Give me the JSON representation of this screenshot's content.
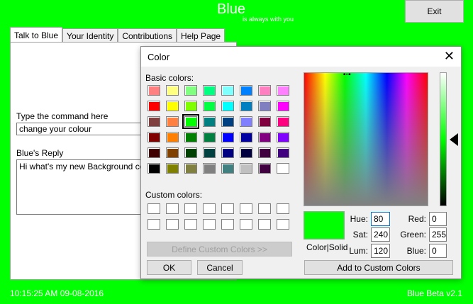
{
  "app": {
    "title": "Blue",
    "subtitle": "is always with you",
    "exit_label": "Exit"
  },
  "tabs": [
    {
      "label": "Talk to Blue",
      "active": true
    },
    {
      "label": "Your Identity",
      "active": false
    },
    {
      "label": "Contributions",
      "active": false
    },
    {
      "label": "Help Page",
      "active": false
    }
  ],
  "main": {
    "command_label": "Type the command here",
    "command_value": "change your colour",
    "reply_label": "Blue's Reply",
    "reply_text": "Hi what's my new Background colour"
  },
  "status": {
    "datetime": "10:15:25 AM   09-08-2016",
    "version": "Blue Beta v2.1"
  },
  "color_dialog": {
    "title": "Color",
    "basic_colors_label": "Basic colors:",
    "custom_colors_label": "Custom colors:",
    "define_custom_label": "Define Custom Colors >>",
    "ok_label": "OK",
    "cancel_label": "Cancel",
    "add_custom_label": "Add to Custom Colors",
    "color_solid_label": "Color|Solid",
    "hue_label": "Hue:",
    "hue_value": "80",
    "sat_label": "Sat:",
    "sat_value": "240",
    "lum_label": "Lum:",
    "lum_value": "120",
    "red_label": "Red:",
    "red_value": "0",
    "green_label": "Green:",
    "green_value": "255",
    "blue_label": "Blue:",
    "blue_value": "0",
    "selected_color": "#00ff00",
    "basic_colors": [
      "#ff8080",
      "#ffff80",
      "#80ff80",
      "#00ff80",
      "#80ffff",
      "#0080ff",
      "#ff80c0",
      "#ff80ff",
      "#ff0000",
      "#ffff00",
      "#80ff00",
      "#00ff40",
      "#00ffff",
      "#0080c0",
      "#8080c0",
      "#ff00ff",
      "#804040",
      "#ff8040",
      "#00ff00",
      "#008080",
      "#004080",
      "#8080ff",
      "#800040",
      "#ff0080",
      "#800000",
      "#ff8000",
      "#008000",
      "#008040",
      "#0000ff",
      "#0000a0",
      "#800080",
      "#8000ff",
      "#400000",
      "#804000",
      "#004000",
      "#004040",
      "#000080",
      "#000040",
      "#400040",
      "#400080",
      "#000000",
      "#808000",
      "#808040",
      "#808080",
      "#408080",
      "#c0c0c0",
      "#400040",
      "#ffffff"
    ]
  }
}
